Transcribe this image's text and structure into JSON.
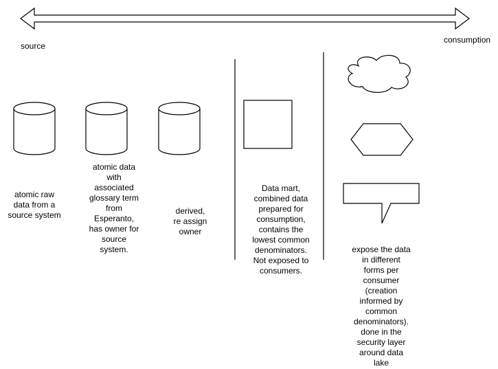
{
  "axis": {
    "start_label": "source",
    "end_label": "consumption"
  },
  "nodes": [
    {
      "id": "atomic-raw",
      "shape": "cylinder",
      "label": "atomic raw\ndata from a\nsource system"
    },
    {
      "id": "atomic-glossary",
      "shape": "cylinder",
      "label": "atomic data\nwith\nassociated\nglossary term\nfrom\nEsperanto,\nhas owner for\nsource\nsystem."
    },
    {
      "id": "derived",
      "shape": "cylinder",
      "label": "derived,\nre assign\nowner"
    },
    {
      "id": "data-mart",
      "shape": "square",
      "label": "Data mart,\ncombined data\nprepared for\nconsumption,\ncontains the\nlowest common\ndenominators.\nNot exposed to\nconsumers."
    },
    {
      "id": "expose-cloud",
      "shape": "cloud",
      "label": ""
    },
    {
      "id": "expose-hexagon",
      "shape": "hexagon",
      "label": ""
    },
    {
      "id": "expose-callout",
      "shape": "callout",
      "label": "expose the data\nin different\nforms per\nconsumer\n(creation\ninformed by\ncommon\ndenominators).\ndone in the\nsecurity layer\naround data\nlake"
    }
  ],
  "colors": {
    "stroke": "#000000",
    "fill": "#ffffff",
    "background": "#ffffff"
  }
}
